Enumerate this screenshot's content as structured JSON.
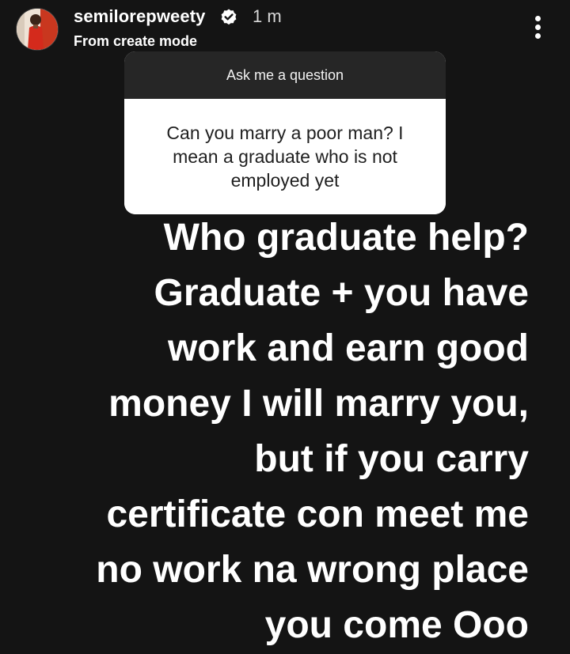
{
  "header": {
    "username": "semilorepweety",
    "timestamp": "1 m",
    "subtitle": "From create mode",
    "verified_icon": "verified-badge-icon",
    "more_icon": "more-vertical-icon"
  },
  "question_sticker": {
    "prompt": "Ask me a question",
    "question": "Can you marry a poor man? I mean a graduate who is not employed yet"
  },
  "answer": {
    "lines": [
      "Who graduate help?",
      "Graduate + you have",
      "work and earn good",
      "money I will marry you,",
      "but if you carry",
      "certificate con meet me",
      "no work na wrong place",
      "you come Ooo"
    ]
  },
  "colors": {
    "background": "#141414",
    "card_header": "#262626",
    "card_body": "#ffffff",
    "text": "#ffffff"
  }
}
